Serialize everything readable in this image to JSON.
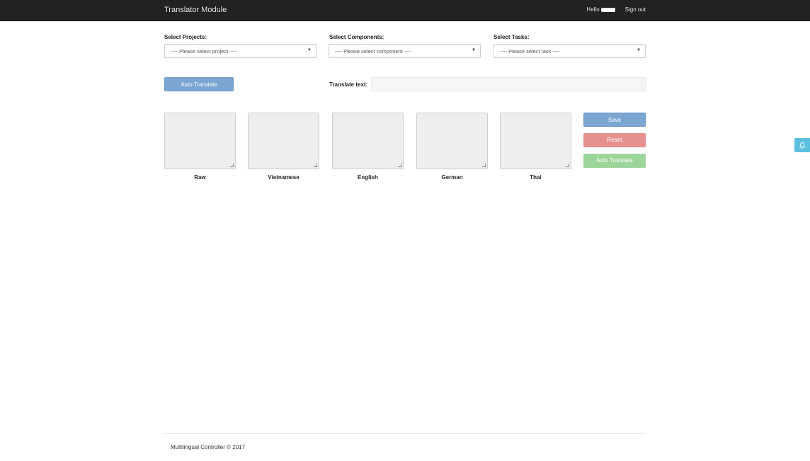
{
  "navbar": {
    "brand": "Translator Module",
    "greeting": "Hello",
    "sign_out": "Sign out"
  },
  "filters": {
    "projects": {
      "label": "Select Projects:",
      "value": "---- Please select project ----"
    },
    "components": {
      "label": "Select Components:",
      "value": "---- Please select component ----"
    },
    "tasks": {
      "label": "Select Tasks:",
      "value": "---- Please select task ----"
    }
  },
  "actions": {
    "auto_translate": "Auto Translate",
    "translate_text_label": "Translate text:"
  },
  "languages": [
    "Raw",
    "Vietnamese",
    "English",
    "German",
    "Thai"
  ],
  "side_buttons": {
    "save": "Save",
    "reset": "Reset",
    "auto_translate": "Auto Translate"
  },
  "notification": {
    "icon": "bell-icon"
  },
  "footer": {
    "text": "Multilingual Controller © 2017"
  }
}
